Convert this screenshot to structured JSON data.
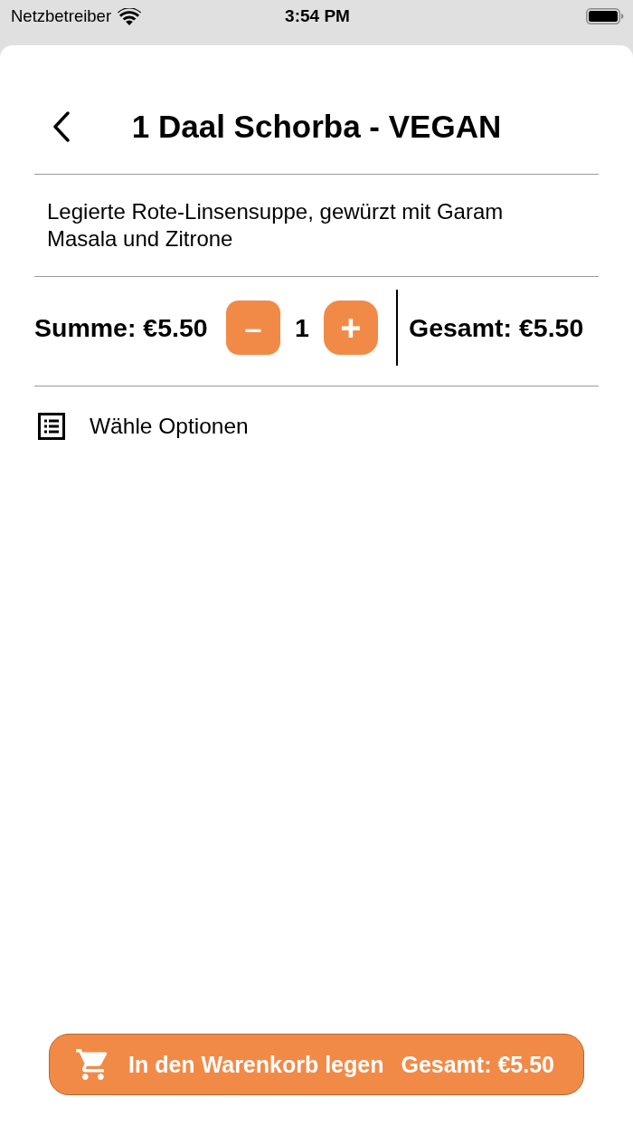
{
  "status_bar": {
    "carrier": "Netzbetreiber",
    "time": "3:54 PM"
  },
  "header": {
    "title": "1 Daal Schorba - VEGAN"
  },
  "description": "Legierte Rote-Linsensuppe, gewürzt mit Garam Masala und Zitrone",
  "quantity_row": {
    "subtotal": "Summe: €5.50",
    "decrement": "–",
    "quantity": "1",
    "increment": "+",
    "total": "Gesamt: €5.50"
  },
  "options": {
    "label": "Wähle Optionen"
  },
  "cart_button": {
    "label": "In den Warenkorb legen",
    "total": "Gesamt: €5.50"
  }
}
